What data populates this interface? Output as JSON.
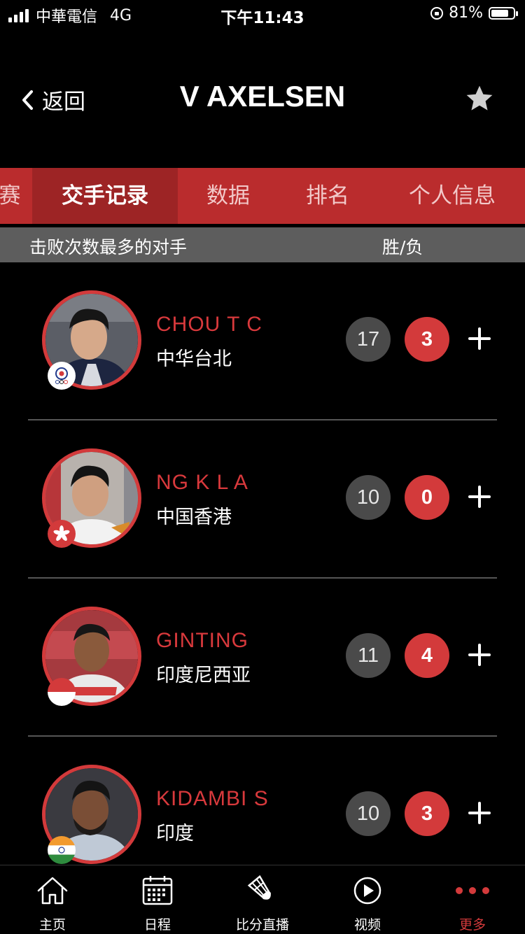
{
  "status_bar": {
    "carrier": "中華電信",
    "network": "4G",
    "time": "下午11:43",
    "battery": "81%"
  },
  "header": {
    "back_label": "返回",
    "title": "V AXELSEN"
  },
  "tabs": [
    {
      "label": "赛",
      "active": false
    },
    {
      "label": "交手记录",
      "active": true
    },
    {
      "label": "数据",
      "active": false
    },
    {
      "label": "排名",
      "active": false
    },
    {
      "label": "个人信息",
      "active": false
    }
  ],
  "column_header": {
    "left": "击败次数最多的对手",
    "right": "胜/负"
  },
  "opponents": [
    {
      "name": "CHOU T C",
      "country": "中华台北",
      "wins": "17",
      "losses": "3"
    },
    {
      "name": "NG K L A",
      "country": "中国香港",
      "wins": "10",
      "losses": "0"
    },
    {
      "name": "GINTING",
      "country": "印度尼西亚",
      "wins": "11",
      "losses": "4"
    },
    {
      "name": "KIDAMBI S",
      "country": "印度",
      "wins": "10",
      "losses": "3"
    }
  ],
  "bottom_nav": [
    {
      "label": "主页",
      "icon": "home-icon"
    },
    {
      "label": "日程",
      "icon": "calendar-icon"
    },
    {
      "label": "比分直播",
      "icon": "shuttlecock-icon"
    },
    {
      "label": "视频",
      "icon": "play-icon"
    },
    {
      "label": "更多",
      "icon": "more-dots-icon",
      "active": true
    }
  ],
  "colors": {
    "accent_red": "#d33a3b",
    "tab_bar": "#ba2c2d",
    "tab_active": "#9d2425",
    "wins_badge": "#4a4a4a"
  }
}
